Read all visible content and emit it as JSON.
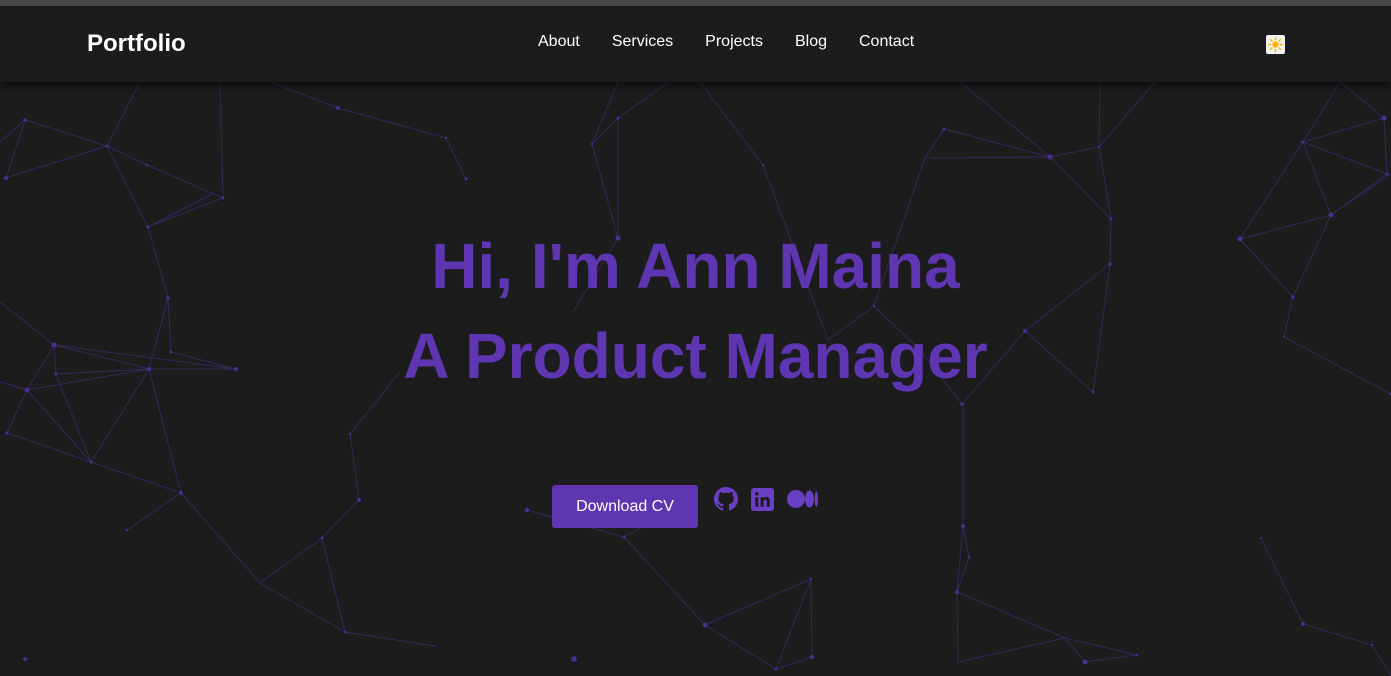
{
  "nav": {
    "brand": "Portfolio",
    "links": [
      "About",
      "Services",
      "Projects",
      "Blog",
      "Contact"
    ],
    "theme_toggle_icon": "sun-icon"
  },
  "hero": {
    "line1": "Hi, I'm Ann Maina",
    "line2": "A Product Manager",
    "cta_label": "Download CV",
    "social_icons": [
      "github-icon",
      "linkedin-icon",
      "medium-icon"
    ]
  },
  "colors": {
    "background": "#1c1c1c",
    "accent": "#5e36b2",
    "text": "#ffffff"
  }
}
